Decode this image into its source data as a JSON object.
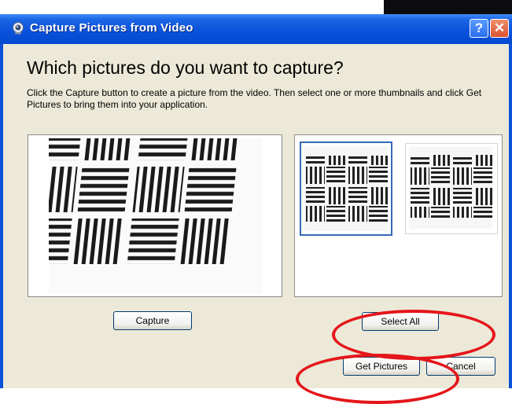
{
  "window": {
    "title": "Capture Pictures from Video",
    "help_label": "?",
    "close_label": "✕"
  },
  "main": {
    "heading": "Which pictures do you want to capture?",
    "description": "Click the Capture button to create a picture from the video.  Then select one or more thumbnails and click Get Pictures to bring them into your application."
  },
  "buttons": {
    "capture": "Capture",
    "select_all": "Select All",
    "get_pictures": "Get Pictures",
    "cancel": "Cancel"
  },
  "thumbnails": {
    "count": 2,
    "selected_index": 0
  },
  "colors": {
    "title_bar": "#0a53dc",
    "dialog_bg": "#ece9d8",
    "selection_border": "#3569b6",
    "annotation": "#e4161a"
  },
  "icons": {
    "title": "webcam-icon",
    "help": "help-icon",
    "close": "close-icon"
  }
}
